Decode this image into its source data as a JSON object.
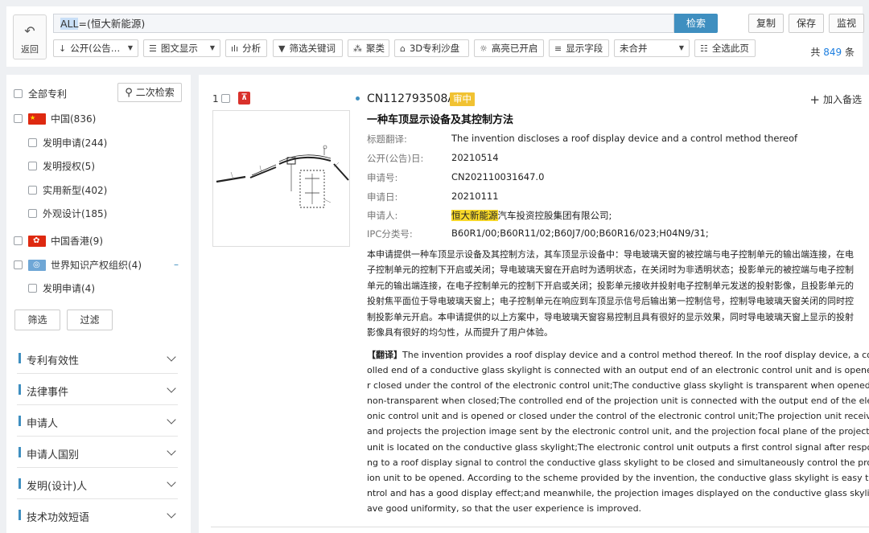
{
  "topbar": {
    "back_label": "返回",
    "query_prefix": "ALL",
    "query_rest": "=(恒大新能源)",
    "search_label": "检索",
    "copy_label": "复制",
    "save_label": "保存",
    "monitor_label": "监视",
    "total_prefix": "共",
    "total_count": "849",
    "total_suffix": "条"
  },
  "toolbar": {
    "sort_label": "公开(公告…",
    "view_label": "图文显示",
    "analysis_label": "分析",
    "filter_kw_label": "筛选关键词",
    "cluster_label": "聚类",
    "sandbox_label": "3D专利沙盘",
    "highlight_label": "高亮已开启",
    "fields_label": "显示字段",
    "merge_label": "未合并",
    "select_all_label": "全选此页"
  },
  "sidebar": {
    "all_label": "全部专利",
    "second_search_label": "二次检索",
    "tree": [
      {
        "label": "中国(836)",
        "level": 0,
        "flag": "cn"
      },
      {
        "label": "发明申请(244)",
        "level": 1
      },
      {
        "label": "发明授权(5)",
        "level": 1
      },
      {
        "label": "实用新型(402)",
        "level": 1
      },
      {
        "label": "外观设计(185)",
        "level": 1
      },
      {
        "label": "中国香港(9)",
        "level": 0,
        "flag": "hk"
      },
      {
        "label": "世界知识产权组织(4)",
        "level": 0,
        "flag": "wipo"
      },
      {
        "label": "发明申请(4)",
        "level": 1
      }
    ],
    "filter_button": "筛选",
    "exclude_button": "过滤",
    "sections": [
      "专利有效性",
      "法律事件",
      "申请人",
      "申请人国别",
      "发明(设计)人",
      "技术功效短语"
    ]
  },
  "result": {
    "index": "1",
    "pdf_label": "PDF",
    "pub_number": "CN112793508A",
    "status": "审中",
    "add_label": "加入备选",
    "title": "一种车顶显示设备及其控制方法",
    "fields": {
      "title_trans_k": "标题翻译:",
      "title_trans_v": "The invention discloses a roof display device and a control method thereof",
      "pub_date_k": "公开(公告)日:",
      "pub_date_v": "20210514",
      "app_no_k": "申请号:",
      "app_no_v": "CN202110031647.0",
      "app_date_k": "申请日:",
      "app_date_v": "20210111",
      "applicant_k": "申请人:",
      "applicant_hl": "恒大新能源",
      "applicant_rest": "汽车投资控股集团有限公司;",
      "ipc_k": "IPC分类号:",
      "ipc_v": "B60R1/00;B60R11/02;B60J7/00;B60R16/023;H04N9/31;"
    },
    "abstract_lines": [
      "本申请提供一种车顶显示设备及其控制方法，其车顶显示设备中：导电玻璃天窗的被控端与电子控制单元的输出端连接，在电",
      "子控制单元的控制下开启或关闭；导电玻璃天窗在开启时为透明状态，在关闭时为非透明状态；投影单元的被控端与电子控制",
      "单元的输出端连接，在电子控制单元的控制下开启或关闭；投影单元接收并投射电子控制单元发送的投射影像，且投影单元的",
      "投射焦平面位于导电玻璃天窗上；电子控制单元在响应到车顶显示信号后输出第一控制信号，控制导电玻璃天窗关闭的同时控",
      "制投影单元开启。本申请提供的以上方案中，导电玻璃天窗容易控制且具有很好的显示效果，同时导电玻璃天窗上显示的投射",
      "影像具有很好的均匀性，从而提升了用户体验。"
    ],
    "translation_tag": "【翻译】",
    "translation_lines": [
      "The invention provides a roof display device and a control method thereof. In the roof display device, a contr",
      "olled end of a conductive glass skylight is connected with an output end of an electronic control unit and is opened o",
      "r closed under the control of the electronic control unit;The conductive glass skylight is transparent when opened and",
      "non-transparent when closed;The controlled end of the projection unit is connected with the output end of the electr",
      "onic control unit and is opened or closed under the control of the electronic control unit;The projection unit receives",
      "and projects the projection image sent by the electronic control unit, and the projection focal plane of the projection",
      "unit is located on the conductive glass skylight;The electronic control unit outputs a first control signal after respondi",
      "ng to a roof display signal to control the conductive glass skylight to be closed and simultaneously control the projec",
      "ion unit to be opened. According to the scheme provided by the invention, the conductive glass skylight is easy to co",
      "ntrol and has a good display effect;and meanwhile, the projection images displayed on the conductive glass skylight h",
      "ave good uniformity, so that the user experience is improved."
    ]
  },
  "colors": {
    "accent": "#3f8fc0",
    "status": "#f1c232",
    "highlight": "#f8d92a",
    "count": "#1c7ee0"
  },
  "icons": [
    "back-arrow-icon",
    "sort-icon",
    "list-icon",
    "chart-icon",
    "funnel-icon",
    "cluster-icon",
    "cube-icon",
    "sun-icon",
    "lines-icon",
    "checklist-icon",
    "search-icon",
    "pdf-icon",
    "plus-icon",
    "chevron-down-icon"
  ]
}
